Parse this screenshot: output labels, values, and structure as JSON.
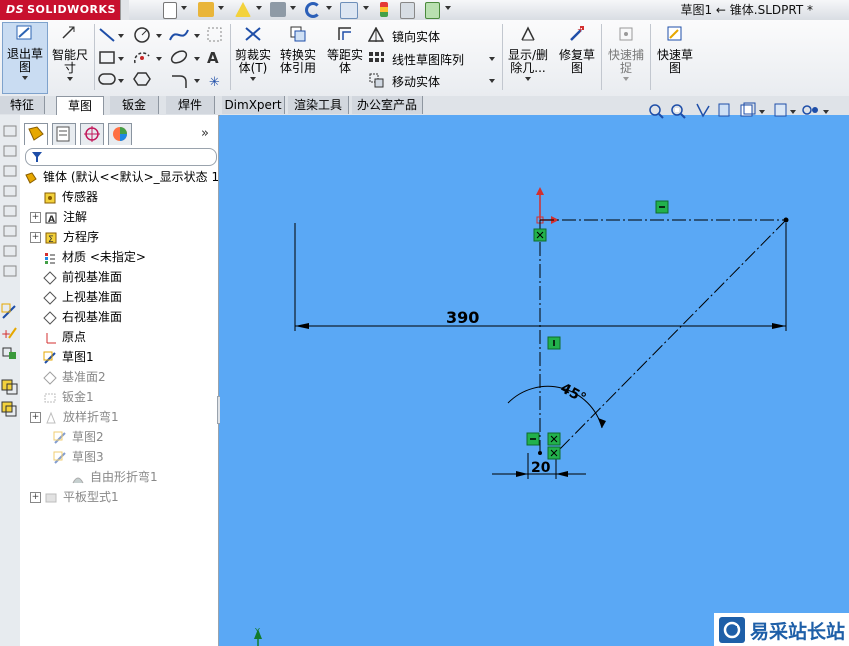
{
  "titlebar": {
    "logo_text": "SOLIDWORKS",
    "logo_prefix": "DS",
    "document_title": "草图1 ← 锥体.SLDPRT *"
  },
  "commands": {
    "exit_sketch": "退出草\n图",
    "smart_dimension": "智能尺\n寸",
    "trim_entities": "剪裁实\n体(T)",
    "convert_entities": "转换实\n体引用",
    "offset_entities": "等距实\n体",
    "mirror_entities": "镜向实体",
    "linear_pattern": "线性草图阵列",
    "move_entities": "移动实体",
    "display_delete_relations": "显示/删\n除几...",
    "repair_sketch": "修复草\n图",
    "quick_snaps": "快速捕\n捉",
    "rapid_sketch": "快速草\n图"
  },
  "tabs": [
    "特征",
    "草图",
    "钣金",
    "焊件",
    "DimXpert",
    "渲染工具",
    "办公室产品"
  ],
  "active_tab": "草图",
  "feature_tree": {
    "root": "锥体  (默认<<默认>_显示状态 1",
    "items": [
      {
        "label": "传感器",
        "expandable": false,
        "icon": "sensor-icon",
        "dim": false
      },
      {
        "label": "注解",
        "expandable": true,
        "icon": "annotation-icon",
        "dim": false
      },
      {
        "label": "方程序",
        "expandable": true,
        "icon": "equation-icon",
        "dim": false
      },
      {
        "label": "材质 <未指定>",
        "expandable": false,
        "icon": "material-icon",
        "dim": false
      },
      {
        "label": "前视基准面",
        "expandable": false,
        "icon": "plane-icon",
        "dim": false
      },
      {
        "label": "上视基准面",
        "expandable": false,
        "icon": "plane-icon",
        "dim": false
      },
      {
        "label": "右视基准面",
        "expandable": false,
        "icon": "plane-icon",
        "dim": false
      },
      {
        "label": "原点",
        "expandable": false,
        "icon": "origin-icon",
        "dim": false
      },
      {
        "label": "草图1",
        "expandable": false,
        "icon": "sketch-icon",
        "dim": false
      },
      {
        "label": "基准面2",
        "expandable": false,
        "icon": "plane-icon",
        "dim": true
      },
      {
        "label": "钣金1",
        "expandable": false,
        "icon": "sheetmetal-icon",
        "dim": true
      },
      {
        "label": "放样折弯1",
        "expandable": true,
        "icon": "loft-bend-icon",
        "dim": true
      },
      {
        "label": "草图2",
        "expandable": false,
        "icon": "sketch-icon",
        "dim": true
      },
      {
        "label": "草图3",
        "expandable": false,
        "icon": "sketch-icon",
        "dim": true
      },
      {
        "label": "自由形折弯1",
        "expandable": false,
        "icon": "freeform-bend-icon",
        "dim": true
      },
      {
        "label": "平板型式1",
        "expandable": true,
        "icon": "flat-pattern-icon",
        "dim": true
      }
    ]
  },
  "sketch": {
    "dim_length": "390",
    "dim_angle": "45°",
    "dim_small": "20"
  },
  "watermark": "易采站长站",
  "colors": {
    "viewport": "#5aa8f5",
    "relation_green": "#22b14c",
    "brand_red": "#c8102e"
  }
}
